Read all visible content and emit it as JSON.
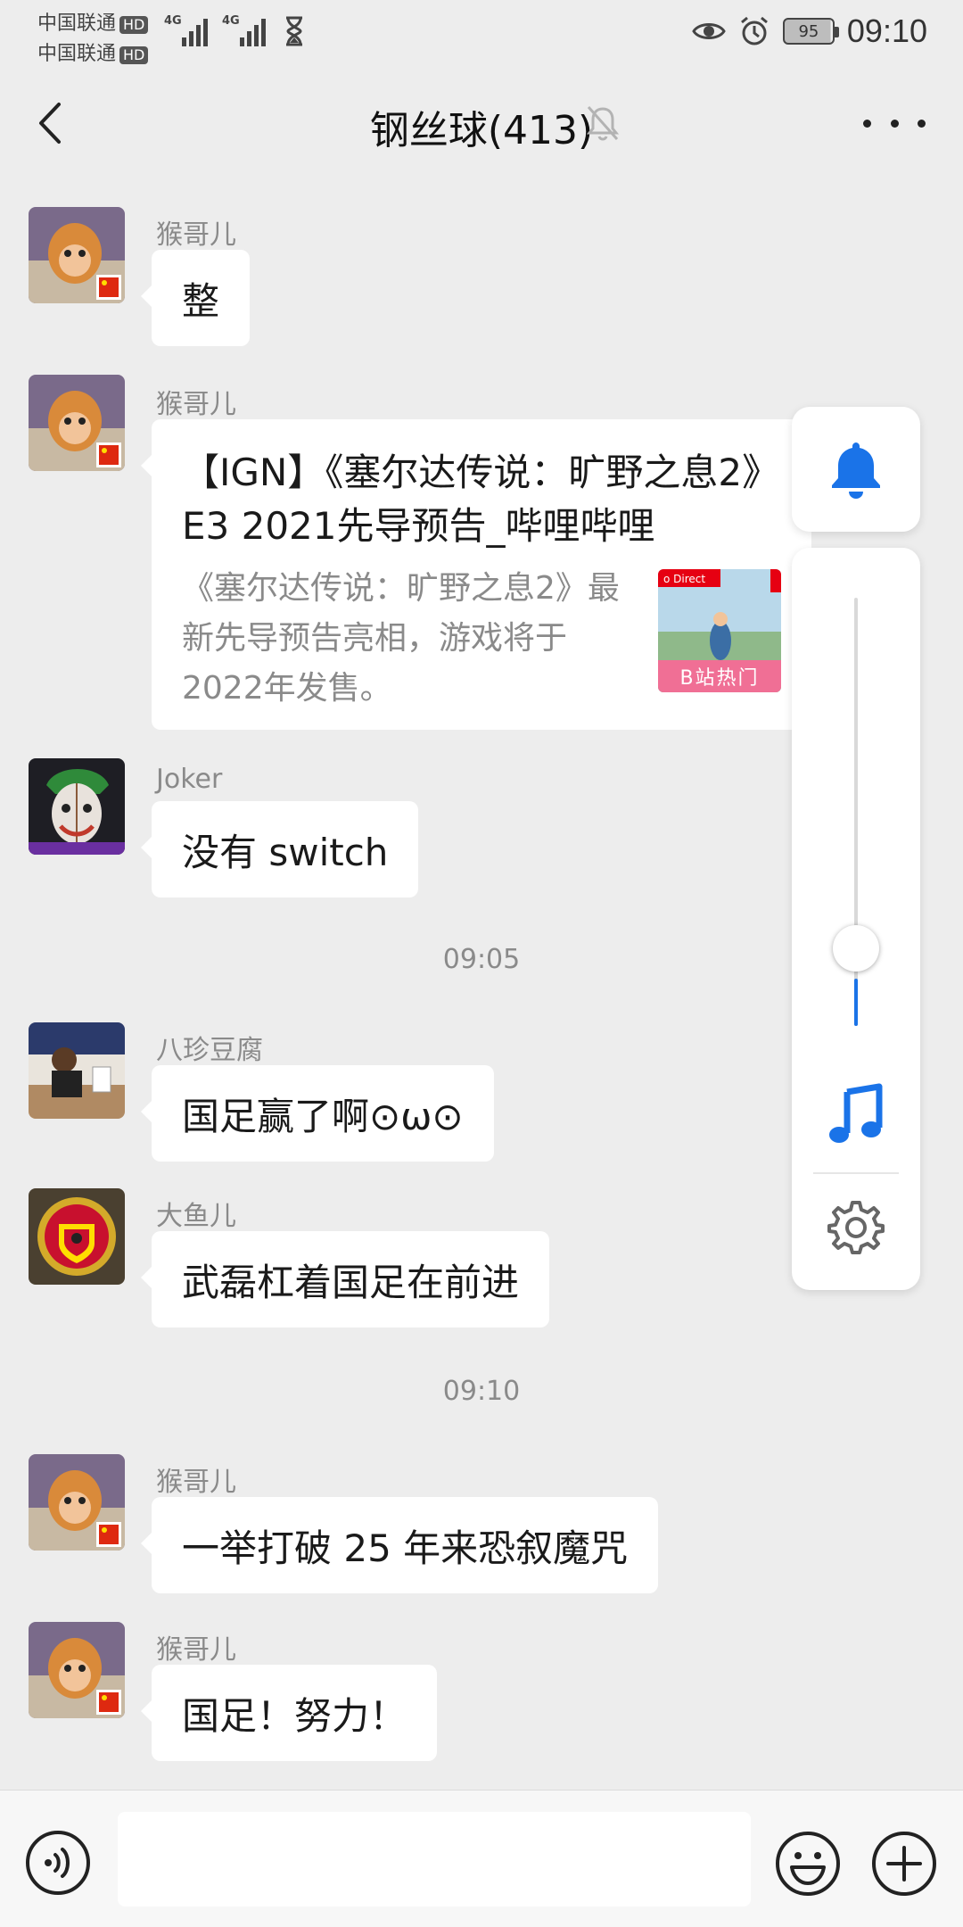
{
  "status_bar": {
    "carrier1": "中国联通",
    "carrier2": "中国联通",
    "hd_badge": "HD",
    "network": "4G",
    "battery": "95",
    "time": "09:10"
  },
  "header": {
    "title": "钢丝球(413)"
  },
  "messages": [
    {
      "sender": "猴哥儿",
      "text": "整"
    },
    {
      "sender": "猴哥儿",
      "card": {
        "title": "【IGN】《塞尔达传说：旷野之息2》E3 2021先导预告_哔哩哔哩",
        "description": "《塞尔达传说：旷野之息2》最新先导预告亮相，游戏将于2022年发售。",
        "thumb_label": "B站热门",
        "thumb_badge": "o Direct"
      }
    },
    {
      "sender": "Joker",
      "text": "没有 switch"
    },
    {
      "sender": "八珍豆腐",
      "text": "国足赢了啊⊙ω⊙"
    },
    {
      "sender": "大鱼儿",
      "text": "武磊杠着国足在前进"
    },
    {
      "sender": "猴哥儿",
      "text": "一举打破 25 年来恐叙魔咒"
    },
    {
      "sender": "猴哥儿",
      "text": "国足！努力！"
    }
  ],
  "timestamps": [
    "09:05",
    "09:10"
  ],
  "volume_panel": {
    "level": 0.11,
    "accent": "#1a73e8"
  },
  "icons": {
    "back": "back-arrow-icon",
    "mute": "bell-off-icon",
    "more": "more-icon",
    "bell": "bell-icon",
    "music": "music-note-icon",
    "settings": "gear-icon",
    "voice": "voice-icon",
    "emoji": "emoji-icon",
    "plus": "plus-icon"
  }
}
